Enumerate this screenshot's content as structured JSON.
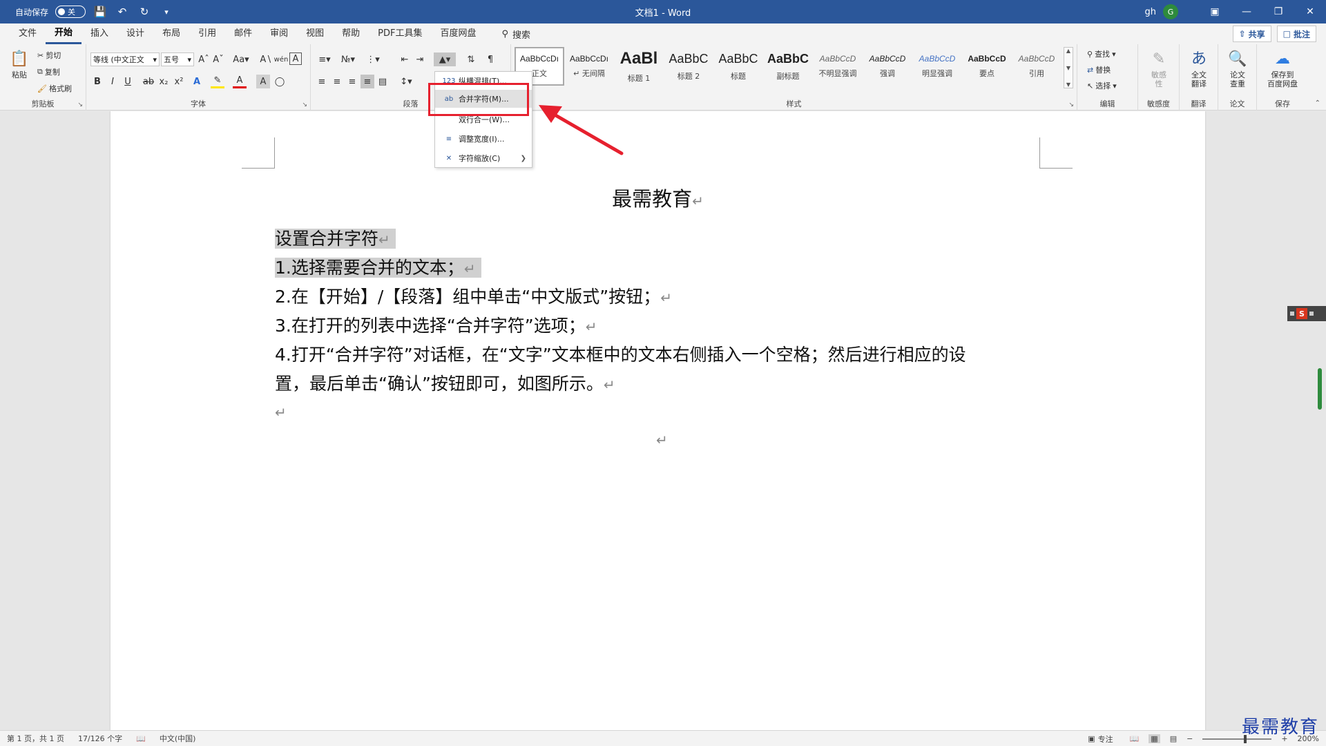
{
  "titlebar": {
    "autosave_label": "自动保存",
    "autosave_state": "关",
    "doc_title": "文档1 - Word",
    "user_name": "gh",
    "avatar_initial": "G"
  },
  "tabs": [
    "文件",
    "开始",
    "插入",
    "设计",
    "布局",
    "引用",
    "邮件",
    "审阅",
    "视图",
    "帮助",
    "PDF工具集",
    "百度网盘"
  ],
  "active_tab": "开始",
  "search_label": "搜索",
  "share_label": "共享",
  "comment_label": "批注",
  "ribbon": {
    "clipboard": {
      "paste": "粘贴",
      "cut": "剪切",
      "copy": "复制",
      "format_painter": "格式刷",
      "label": "剪贴板"
    },
    "font": {
      "font_name": "等线 (中文正文",
      "font_size": "五号",
      "label": "字体"
    },
    "paragraph": {
      "label": "段落"
    },
    "styles": {
      "label": "样式",
      "items": [
        {
          "preview": "AaBbCcDı",
          "name": "正文"
        },
        {
          "preview": "AaBbCcDı",
          "name": "↵ 无间隔"
        },
        {
          "preview": "AaBl",
          "name": "标题 1"
        },
        {
          "preview": "AaBbC",
          "name": "标题 2"
        },
        {
          "preview": "AaBbC",
          "name": "标题"
        },
        {
          "preview": "AaBbC",
          "name": "副标题"
        },
        {
          "preview": "AaBbCcD",
          "name": "不明显强调"
        },
        {
          "preview": "AaBbCcD",
          "name": "强调"
        },
        {
          "preview": "AaBbCcD",
          "name": "明显强调"
        },
        {
          "preview": "AaBbCcD",
          "name": "要点"
        },
        {
          "preview": "AaBbCcD",
          "name": "引用"
        }
      ]
    },
    "editing": {
      "find": "查找",
      "replace": "替换",
      "select": "选择",
      "label": "编辑"
    },
    "sensitivity": {
      "button": "敏感\n性",
      "label": "敏感度"
    },
    "translate": {
      "button": "全文\n翻译",
      "label": "翻译"
    },
    "paper": {
      "button": "论文\n查重",
      "label": "论文"
    },
    "save": {
      "button": "保存到\n百度网盘",
      "label": "保存"
    }
  },
  "menu": {
    "items": [
      {
        "label": "纵横混排(T)...",
        "icon": "123"
      },
      {
        "label": "合并字符(M)...",
        "icon": "ab"
      },
      {
        "label": "双行合一(W)...",
        "icon": ""
      },
      {
        "label": "调整宽度(I)...",
        "icon": "≡"
      },
      {
        "label": "字符缩放(C)",
        "icon": "✕"
      }
    ]
  },
  "document": {
    "title": "最需教育",
    "lines": [
      "设置合并字符",
      "1.选择需要合并的文本；",
      "2.在【开始】/【段落】组中单击“中文版式”按钮；",
      "3.在打开的列表中选择“合并字符”选项；",
      "4.打开“合并字符”对话框，在“文字”文本框中的文本右侧插入一个空格；然后进行相应的设",
      "置，最后单击“确认”按钮即可，如图所示。"
    ],
    "paragraph_mark": "↵"
  },
  "statusbar": {
    "page": "第 1 页，共 1 页",
    "words": "17/126 个字",
    "language": "中文(中国)",
    "focus": "专注",
    "zoom": "200%"
  },
  "watermark": "最需教育"
}
